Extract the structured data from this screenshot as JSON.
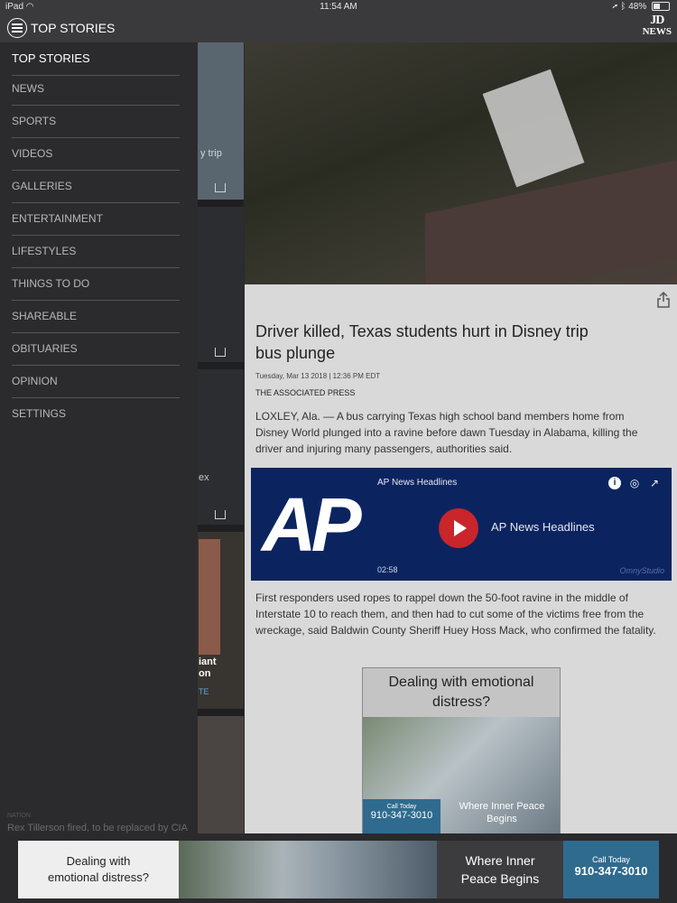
{
  "status_bar": {
    "carrier": "iPad",
    "time": "11:54 AM",
    "battery": "48%",
    "battery_level": 0.48
  },
  "header": {
    "title": "TOP STORIES",
    "logo_line1": "JD",
    "logo_line2": "NEWS"
  },
  "menu": {
    "items": [
      {
        "label": "TOP STORIES"
      },
      {
        "label": "NEWS"
      },
      {
        "label": "SPORTS"
      },
      {
        "label": "VIDEOS"
      },
      {
        "label": "GALLERIES"
      },
      {
        "label": "ENTERTAINMENT"
      },
      {
        "label": "LIFESTYLES"
      },
      {
        "label": "THINGS TO DO"
      },
      {
        "label": "SHAREABLE"
      },
      {
        "label": "OBITUARIES"
      },
      {
        "label": "OPINION"
      },
      {
        "label": "SETTINGS"
      }
    ],
    "bottom_caption": "Rex Tillerson fired, to be replaced by CIA chief",
    "bottom_small": "NATION"
  },
  "background_list": {
    "snippet1": "y trip",
    "snippet2": "ex",
    "snippet3a": "iant",
    "snippet3b": "on",
    "snippet3c": "TE"
  },
  "article": {
    "headline": "Driver killed, Texas students hurt in Disney trip bus plunge",
    "date": "Tuesday, Mar 13 2018 | 12:36 PM EDT",
    "source": "THE ASSOCIATED PRESS",
    "paragraph1": "LOXLEY, Ala. — A bus carrying Texas high school band members home from Disney World plunged into a ravine before dawn Tuesday in Alabama, killing the driver and injuring many passengers, authorities said.",
    "paragraph2": "First responders used ropes to rappel down the 50-foot ravine in the middle of Interstate 10 to reach them, and then had to cut some of the victims free from the wreckage, said Baldwin County Sheriff Huey Hoss Mack, who confirmed the fatality."
  },
  "player": {
    "title": "AP News Headlines",
    "name": "AP News Headlines",
    "logo": "AP",
    "duration": "02:58",
    "brand": "OmnyStudio"
  },
  "inline_ad": {
    "headline": "Dealing with emotional distress?",
    "call_label": "Call Today",
    "phone": "910-347-3010",
    "tagline": "Where Inner Peace Begins"
  },
  "banner_ad": {
    "headline_line1": "Dealing with",
    "headline_line2": "emotional distress?",
    "tagline_line1": "Where Inner",
    "tagline_line2": "Peace Begins",
    "call_label": "Call Today",
    "phone": "910-347-3010"
  }
}
